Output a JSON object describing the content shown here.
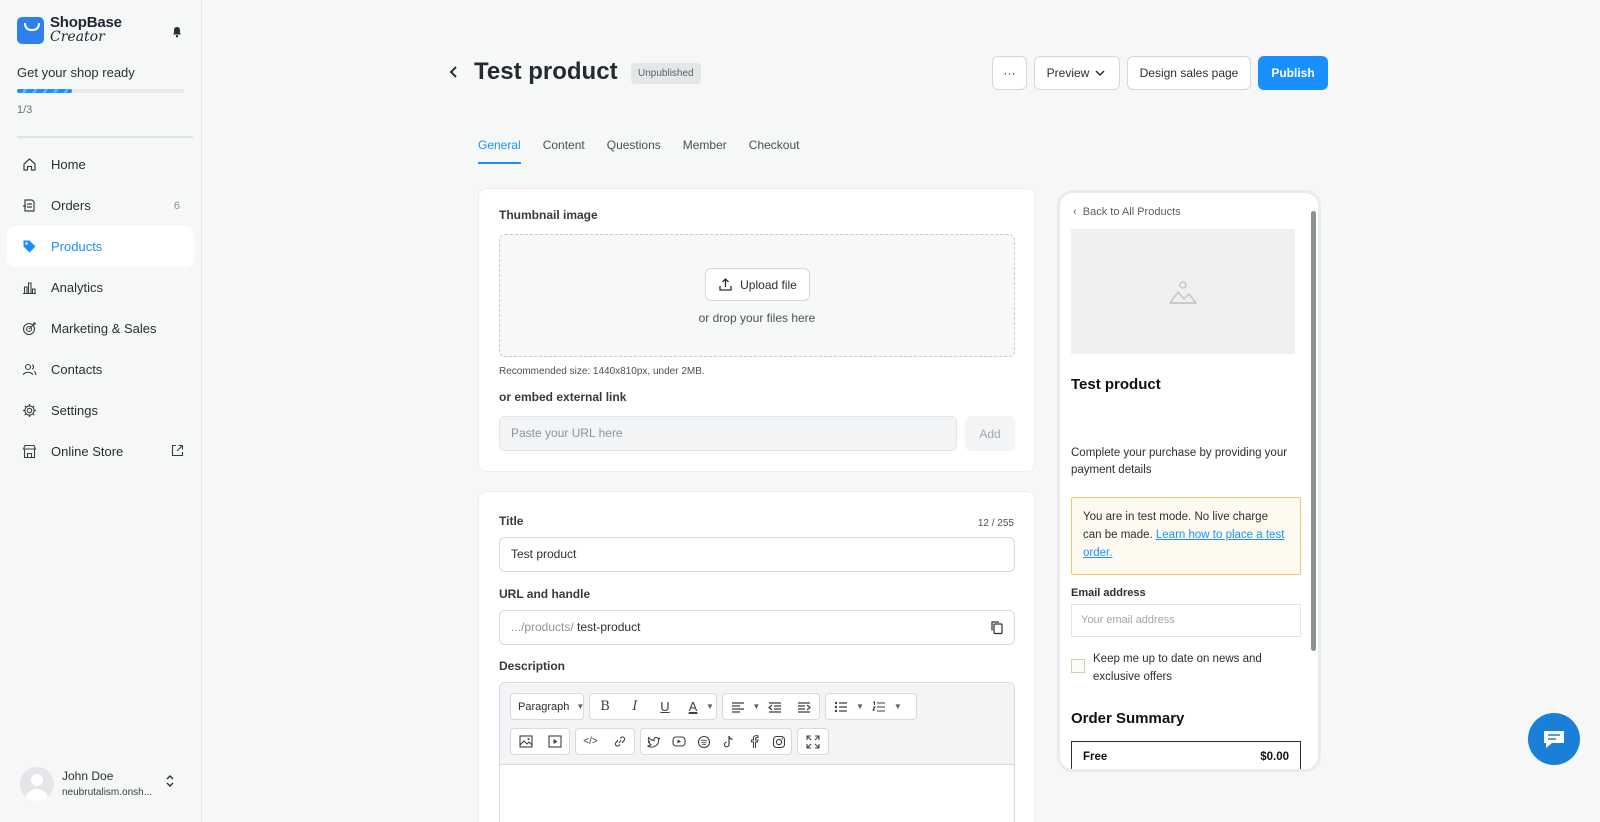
{
  "brand": {
    "line1": "ShopBase",
    "line2": "Creator"
  },
  "setup": {
    "title": "Get your shop ready",
    "count": "1/3",
    "progress": 0.33
  },
  "nav": [
    {
      "label": "Home",
      "icon": "home-icon"
    },
    {
      "label": "Orders",
      "icon": "orders-icon",
      "badge": "6"
    },
    {
      "label": "Products",
      "icon": "tag-icon",
      "active": true
    },
    {
      "label": "Analytics",
      "icon": "analytics-icon"
    },
    {
      "label": "Marketing & Sales",
      "icon": "target-icon"
    },
    {
      "label": "Contacts",
      "icon": "contacts-icon"
    },
    {
      "label": "Settings",
      "icon": "gear-icon"
    },
    {
      "label": "Online Store",
      "icon": "store-icon"
    }
  ],
  "user": {
    "name": "John Doe",
    "shop": "neubrutalism.onsh..."
  },
  "header": {
    "title": "Test product",
    "status": "Unpublished",
    "more_label": "···",
    "preview_label": "Preview",
    "design_label": "Design sales page",
    "publish_label": "Publish"
  },
  "tabs": [
    {
      "label": "General",
      "active": true
    },
    {
      "label": "Content"
    },
    {
      "label": "Questions"
    },
    {
      "label": "Member"
    },
    {
      "label": "Checkout"
    }
  ],
  "thumbnail": {
    "label": "Thumbnail image",
    "upload_label": "Upload file",
    "drop_text": "or drop your files here",
    "hint": "Recommended size: 1440x810px, under 2MB.",
    "embed_label": "or embed external link",
    "url_placeholder": "Paste your URL here",
    "add_label": "Add"
  },
  "details": {
    "title_label": "Title",
    "title_counter": "12 / 255",
    "title_value": "Test product",
    "url_label": "URL and handle",
    "url_prefix": ".../products/",
    "url_value": "test-product",
    "description_label": "Description",
    "paragraph_label": "Paragraph"
  },
  "preview": {
    "back_label": "Back to All Products",
    "title": "Test product",
    "instructions": "Complete your purchase by providing your payment details",
    "notice_text": "You are in test mode. No live charge can be made.",
    "notice_link": "Learn how to place a test order.",
    "email_label": "Email address",
    "email_placeholder": "Your email address",
    "newsletter_label": "Keep me up to date on news and exclusive offers",
    "summary_title": "Order Summary",
    "line_name": "Free",
    "line_price": "$0.00"
  },
  "colors": {
    "accent": "#1a90ff",
    "notice_border": "#f5c36b"
  }
}
